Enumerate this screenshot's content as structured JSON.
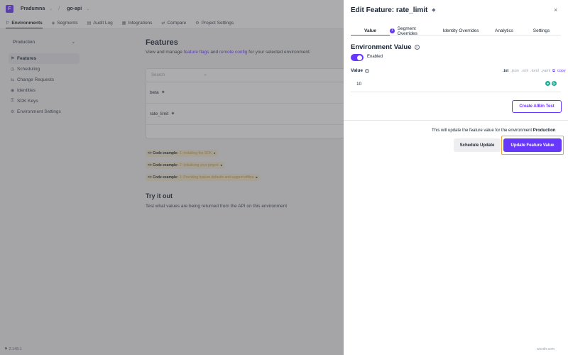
{
  "topbar": {
    "logo_letter": "F",
    "org": "Pradumna",
    "project": "go-api",
    "separator": "/",
    "chevron": "⌄"
  },
  "nav": {
    "items": [
      {
        "label": "Environments",
        "icon": "⚐",
        "icon_name": "environments-icon"
      },
      {
        "label": "Segments",
        "icon": "◈",
        "icon_name": "segments-icon"
      },
      {
        "label": "Audit Log",
        "icon": "▤",
        "icon_name": "audit-log-icon"
      },
      {
        "label": "Integrations",
        "icon": "▦",
        "icon_name": "integrations-icon"
      },
      {
        "label": "Compare",
        "icon": "⇄",
        "icon_name": "compare-icon"
      },
      {
        "label": "Project Settings",
        "icon": "⚙",
        "icon_name": "gear-icon"
      }
    ]
  },
  "sidebar": {
    "environment": "Production",
    "items": [
      {
        "label": "Features",
        "icon": "⚑"
      },
      {
        "label": "Scheduling",
        "icon": "◷"
      },
      {
        "label": "Change Requests",
        "icon": "⇆"
      },
      {
        "label": "Identities",
        "icon": "◉"
      },
      {
        "label": "SDK Keys",
        "icon": "⚿"
      },
      {
        "label": "Environment Settings",
        "icon": "⚙"
      }
    ],
    "version": "2.148.1"
  },
  "main": {
    "title": "Features",
    "desc_prefix": "View and manage ",
    "desc_link1": "feature flags",
    "desc_mid": " and ",
    "desc_link2": "remote config",
    "desc_suffix": " for your selected environment.",
    "search_placeholder": "Search",
    "features": [
      {
        "name": "beta"
      },
      {
        "name": "rate_limit"
      }
    ],
    "code_examples": [
      {
        "prefix": "<> Code example:",
        "link": "1: Installing the SDK"
      },
      {
        "prefix": "<> Code example:",
        "link": "2: Initialising your project"
      },
      {
        "prefix": "<> Code example:",
        "link": "3: Providing feature defaults and support offline"
      }
    ],
    "try_title": "Try it out",
    "try_desc": "Test what values are being returned from the API on this environment"
  },
  "drawer": {
    "title": "Edit Feature: rate_limit",
    "close": "×",
    "tabs": [
      "Value",
      "Segment Overrides",
      "Identity Overrides",
      "Analytics",
      "Settings"
    ],
    "tab_badge": "1",
    "env_value_heading": "Environment Value",
    "enabled_label": "Enabled",
    "value_label": "Value",
    "formats": [
      ".txt",
      ".json",
      ".xml",
      ".toml",
      ".yaml"
    ],
    "copy_label": "copy",
    "value": "10",
    "ab_button": "Create A/B/n Test",
    "update_note_prefix": "This will update the feature value for the environment ",
    "update_note_env": "Production",
    "schedule_button": "Schedule Update",
    "update_button": "Update Feature Value"
  },
  "watermark": "wsxdn.com",
  "colors": {
    "primary": "#6837fc",
    "highlight": "#f2a33a"
  }
}
